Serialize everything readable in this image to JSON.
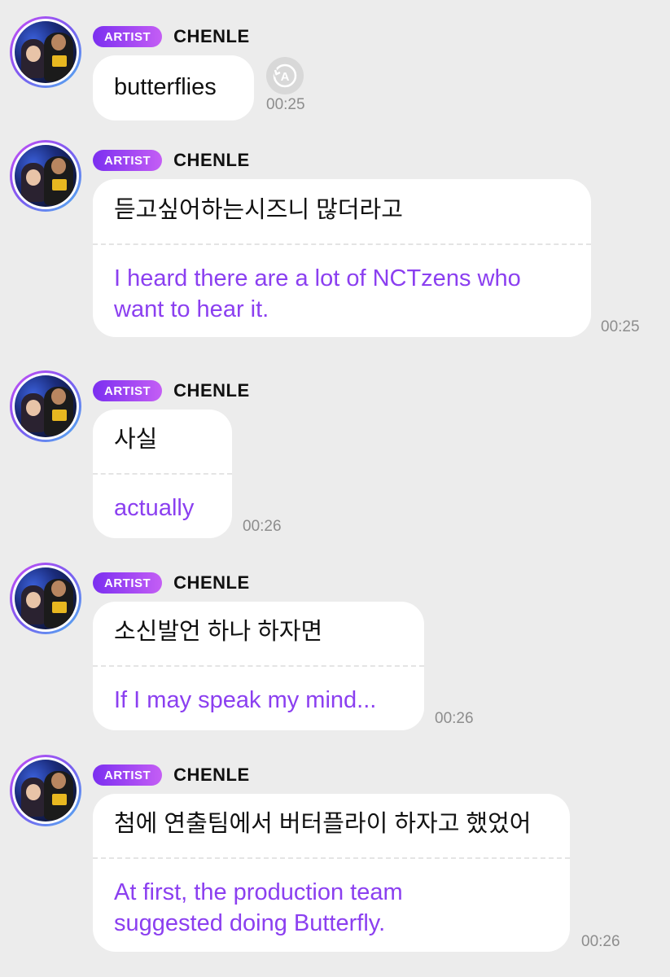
{
  "messages": [
    {
      "badge": "ARTIST",
      "name": "CHENLE",
      "korean": "butterflies",
      "english": "",
      "time": "00:25"
    },
    {
      "badge": "ARTIST",
      "name": "CHENLE",
      "korean": "듣고싶어하는시즈니 많더라고",
      "english": "I heard there are a lot of NCTzens who want to hear it.",
      "english_lines": [
        "I heard there are a lot of NCTzens who",
        "want to hear it."
      ],
      "time": "00:25"
    },
    {
      "badge": "ARTIST",
      "name": "CHENLE",
      "korean": "사실",
      "english": "actually",
      "time": "00:26"
    },
    {
      "badge": "ARTIST",
      "name": "CHENLE",
      "korean": "소신발언 하나 하자면",
      "english": "If I may speak my mind...",
      "time": "00:26"
    },
    {
      "badge": "ARTIST",
      "name": "CHENLE",
      "korean": "첨에 연출팀에서 버터플라이 하자고 했었어",
      "english": "At first, the production team suggested doing Butterfly.",
      "english_lines": [
        "At first, the production team",
        "suggested doing Butterfly."
      ],
      "time": "00:26"
    }
  ],
  "icons": {
    "replay": "replay-translate-icon",
    "avatar": "artist-avatar"
  },
  "colors": {
    "badge_start": "#7b2ff0",
    "badge_end": "#c45ef5",
    "translation": "#8b3ff0",
    "background": "#ececec"
  }
}
